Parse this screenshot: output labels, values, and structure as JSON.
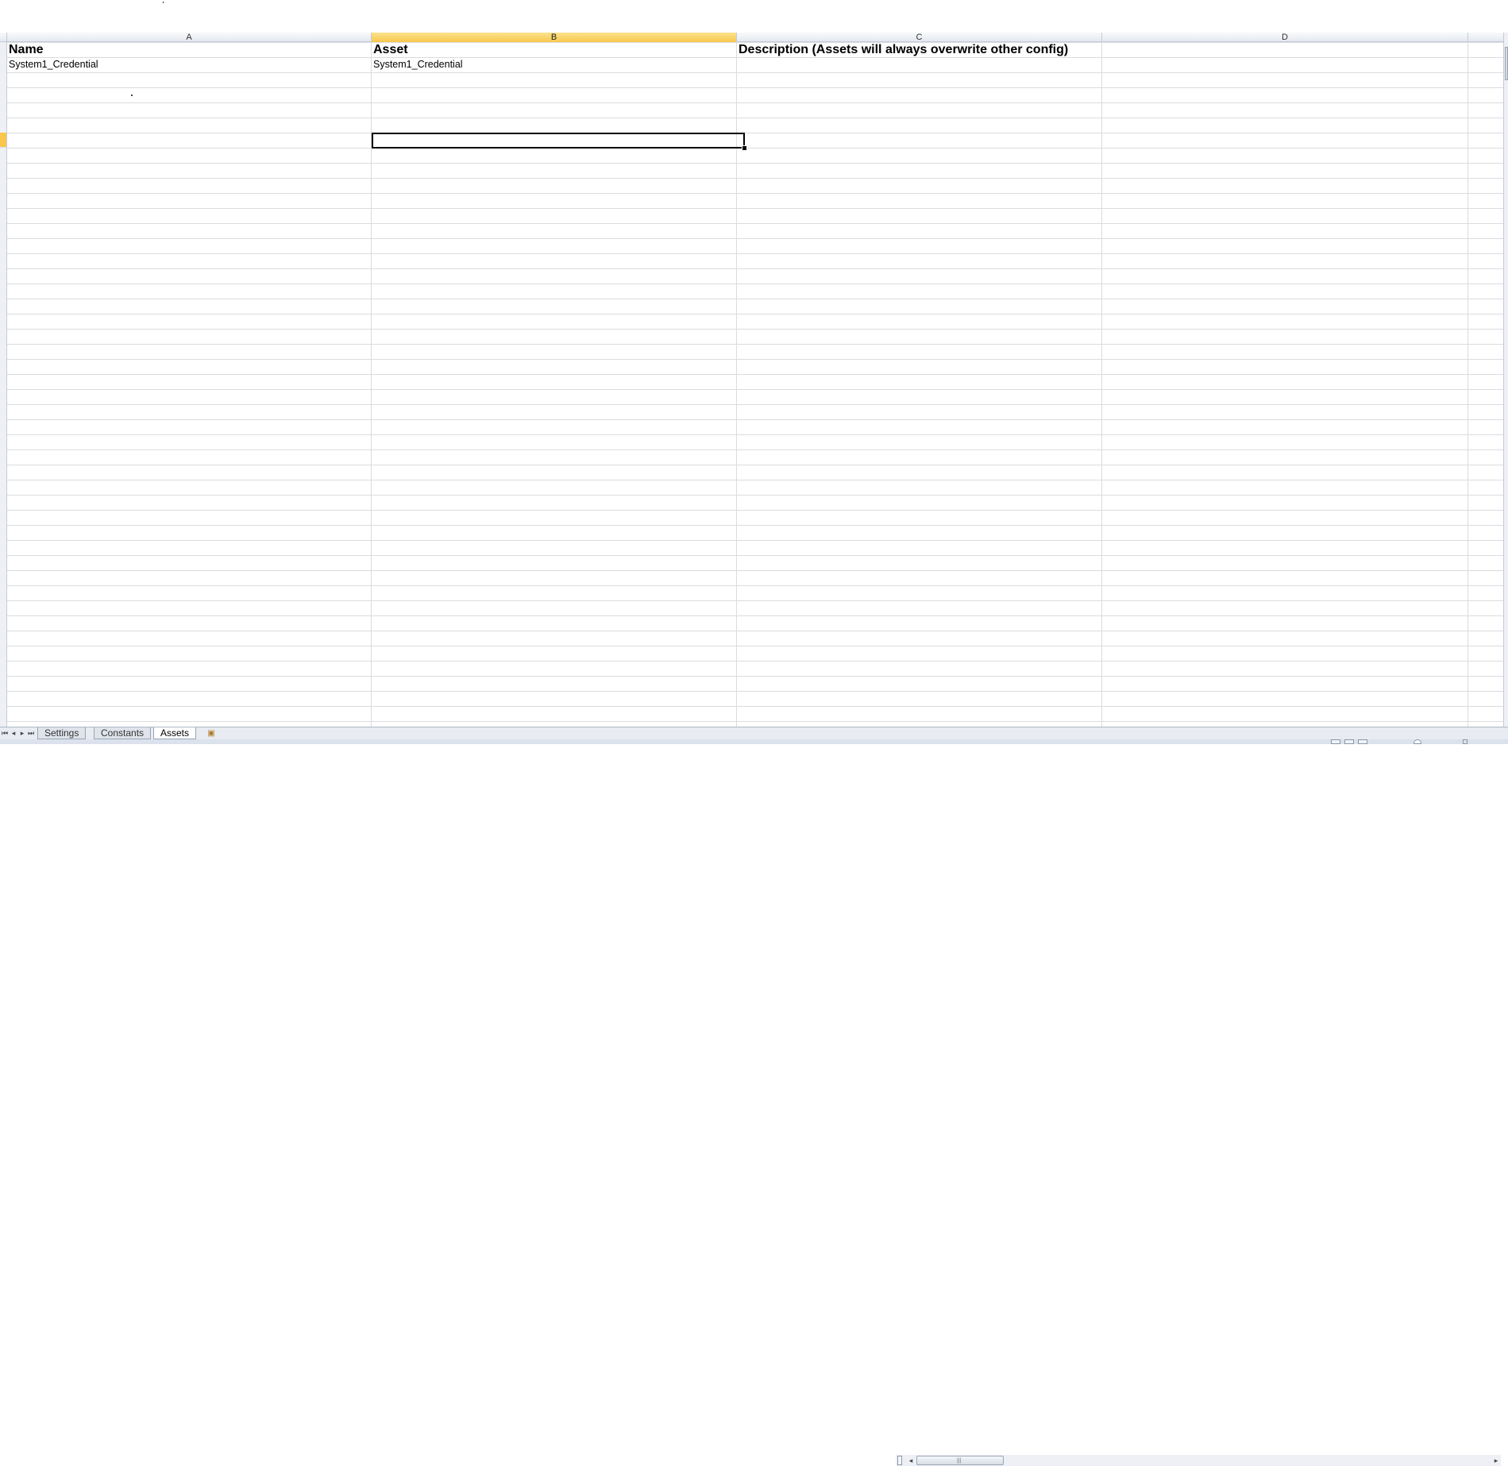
{
  "columns": {
    "a": "A",
    "b": "B",
    "c": "C",
    "d": "D"
  },
  "headers": {
    "name": "Name",
    "asset": "Asset",
    "description": "Description (Assets will always overwrite other config)"
  },
  "rows": [
    {
      "name": "System1_Credential",
      "asset": "System1_Credential"
    }
  ],
  "sheet_tabs": {
    "settings": "Settings",
    "constants": "Constants",
    "assets": "Assets",
    "active": "Assets"
  },
  "icons": {
    "first_sheet": "first-sheet-icon",
    "prev_sheet": "prev-sheet-icon",
    "next_sheet": "next-sheet-icon",
    "last_sheet": "last-sheet-icon",
    "insert_sheet": "insert-sheet-icon"
  },
  "colors": {
    "selected_header": "#f8c74c",
    "gridline": "#dadcdd"
  }
}
